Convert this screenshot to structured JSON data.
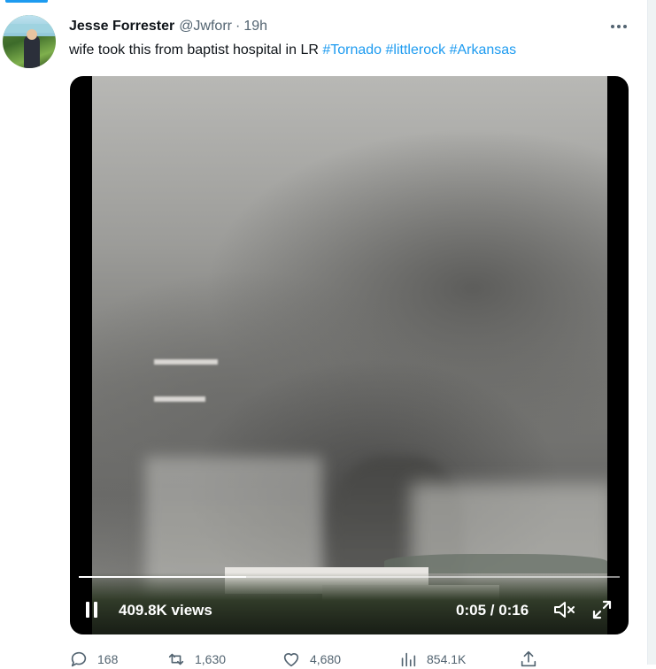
{
  "tweet": {
    "author_name": "Jesse Forrester",
    "handle": "@Jwforr",
    "separator": "·",
    "time": "19h",
    "text_main": "wife took this from baptist hospital in LR ",
    "hashtags": [
      "#Tornado",
      "#littlerock",
      "#Arkansas"
    ],
    "more_icon": "ellipsis-icon"
  },
  "video": {
    "views": "409.8K views",
    "time_display": "0:05 / 0:16",
    "progress": 0.31,
    "pause_icon": "pause-icon",
    "mute_icon": "volume-muted-icon",
    "expand_icon": "expand-icon"
  },
  "actions": {
    "replies": "168",
    "reposts": "1,630",
    "likes": "4,680",
    "views": "854.1K"
  },
  "colors": {
    "accent": "#1d9bf0",
    "text": "#0f1419",
    "secondary": "#536471"
  }
}
